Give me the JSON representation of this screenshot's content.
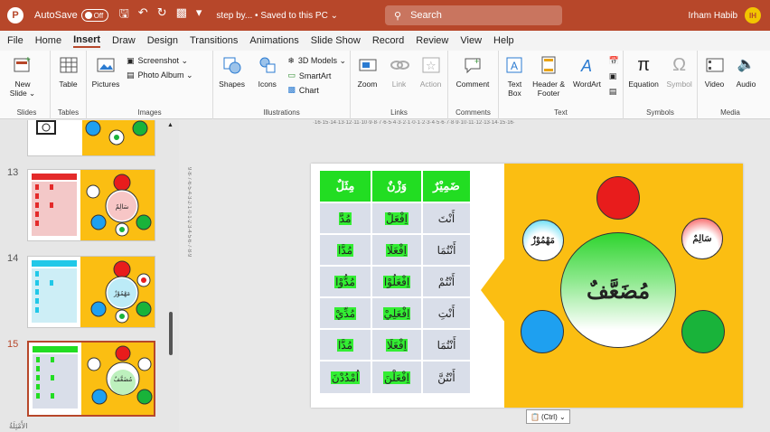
{
  "titlebar": {
    "autosave_label": "AutoSave",
    "autosave_state": "Off",
    "doc_title": "step by...  •  Saved to this PC ⌄",
    "search_placeholder": "Search",
    "user_name": "Irham Habib",
    "user_initials": "IH"
  },
  "menu": {
    "tabs": [
      "File",
      "Home",
      "Insert",
      "Draw",
      "Design",
      "Transitions",
      "Animations",
      "Slide Show",
      "Record",
      "Review",
      "View",
      "Help"
    ],
    "active": "Insert"
  },
  "ribbon": {
    "slides": {
      "new_slide": "New Slide ⌄",
      "title": "Slides"
    },
    "tables": {
      "table": "Table",
      "title": "Tables"
    },
    "images": {
      "pictures": "Pictures",
      "screenshot": "Screenshot ⌄",
      "photo_album": "Photo Album ⌄",
      "title": "Images"
    },
    "illustrations": {
      "shapes": "Shapes",
      "icons": "Icons",
      "models": "3D Models ⌄",
      "smartart": "SmartArt",
      "chart": "Chart",
      "title": "Illustrations"
    },
    "links": {
      "zoom": "Zoom",
      "link": "Link",
      "action": "Action",
      "title": "Links"
    },
    "comments": {
      "comment": "Comment",
      "title": "Comments"
    },
    "text": {
      "text_box": "Text Box",
      "header_footer": "Header & Footer",
      "wordart": "WordArt",
      "title": "Text"
    },
    "symbols": {
      "equation": "Equation",
      "symbol": "Symbol",
      "title": "Symbols"
    },
    "media": {
      "video": "Video",
      "audio": "Audio",
      "title": "Media"
    }
  },
  "thumbnails": [
    {
      "num": "13",
      "center": "سَالِمٌ"
    },
    {
      "num": "14",
      "center": "مَهْمُوْزٌ"
    },
    {
      "num": "15",
      "center": "مُضَعَّفٌ"
    }
  ],
  "bottom_text": "الأَمْثِلَةُ",
  "rulers": {
    "horizontal": "·16·15·14·13·12·11·10·9·8·7·6·5·4·3·2·1·0·1·2·3·4·5·6·7·8·9·10·11·12·13·14·15·16·",
    "vertical": "9·8·7·6·5·4·3·2·1·0·1·2·3·4·5·6·7·8·9"
  },
  "slide": {
    "table": {
      "headers": [
        "ضَمِيْرٌ",
        "وَزْنٌ",
        "مِثَلٌ"
      ],
      "rows": [
        [
          "أَنْتَ",
          "اِفْعَلْ",
          "مُدَّ"
        ],
        [
          "أَنْتُمَا",
          "اِفْعَلَا",
          "مُدَّا"
        ],
        [
          "أَنْتُمْ",
          "اِفْعَلُوْا",
          "مُدُّوْا"
        ],
        [
          "أَنْتِ",
          "اِفْعَلِيْ",
          "مُدِّيْ"
        ],
        [
          "أَنْتُمَا",
          "اِفْعَلَا",
          "مُدَّا"
        ],
        [
          "أَنْتُنَّ",
          "اِفْعَلْنَ",
          "اُمْدُدْنَ"
        ]
      ]
    },
    "center_label": "مُضَعَّفٌ",
    "left_label": "مَهْمُوْزٌ",
    "right_label": "سَالِمٌ"
  },
  "paste_button": "(Ctrl) ⌄",
  "colors": {
    "ppt_red": "#b7472a",
    "orange": "#fbbe12",
    "green": "#22dd22",
    "red_circle": "#e81c1c",
    "blue_circle": "#1ea0f0",
    "green_circle": "#19b33a"
  }
}
